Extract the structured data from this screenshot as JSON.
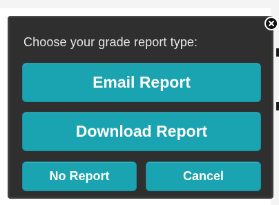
{
  "dialog": {
    "prompt": "Choose your grade report type:",
    "buttons": {
      "email": "Email Report",
      "download": "Download Report",
      "no_report": "No Report",
      "cancel": "Cancel"
    },
    "close_icon": "close-icon"
  },
  "colors": {
    "button_accent": "#1aa3b1",
    "dialog_background": "#2f2f2f",
    "prompt_text": "#e8e8e8"
  }
}
